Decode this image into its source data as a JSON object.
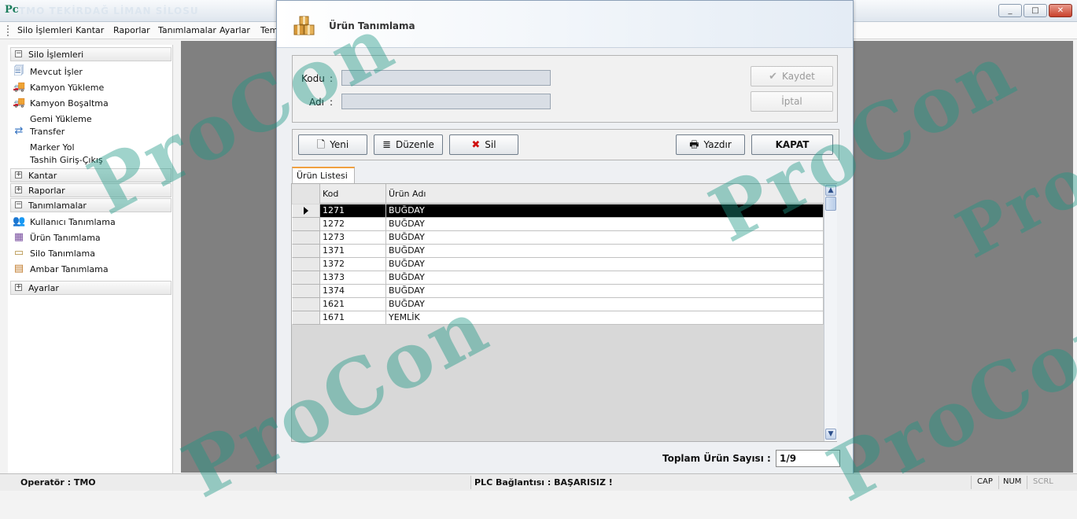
{
  "app": {
    "icon_text": "Pc",
    "title": "TMO TEKİRDAĞ LİMAN SİLOSU",
    "window_buttons": [
      "_",
      "□",
      "✕"
    ]
  },
  "menu": {
    "items": [
      "Silo İşlemleri",
      "Kantar",
      "Raporlar",
      "Tanımlamalar",
      "Ayarlar",
      "Tem"
    ]
  },
  "sidebar": {
    "groups": [
      {
        "label": "Silo İşlemleri",
        "expanded": true,
        "toggle": "−"
      },
      {
        "label": "Kantar",
        "expanded": false,
        "toggle": "+"
      },
      {
        "label": "Raporlar",
        "expanded": false,
        "toggle": "+"
      },
      {
        "label": "Tanımlamalar",
        "expanded": true,
        "toggle": "−"
      },
      {
        "label": "Ayarlar",
        "expanded": false,
        "toggle": "+"
      }
    ],
    "silo_items": [
      {
        "label": "Mevcut İşler",
        "icon": "document-icon"
      },
      {
        "label": "Kamyon Yükleme",
        "icon": "truck-load-icon"
      },
      {
        "label": "Kamyon Boşaltma",
        "icon": "truck-unload-icon"
      },
      {
        "label": "Gemi Yükleme",
        "icon": "transfer-icon"
      },
      {
        "label": "Transfer",
        "icon": "transfer-icon"
      },
      {
        "label": "Marker Yol",
        "icon": ""
      },
      {
        "label": "Tashih Giriş-Çıkış",
        "icon": ""
      }
    ],
    "tanim_items": [
      {
        "label": "Kullanıcı Tanımlama",
        "icon": "users-icon"
      },
      {
        "label": "Ürün Tanımlama",
        "icon": "product-icon"
      },
      {
        "label": "Silo Tanımlama",
        "icon": "silo-icon"
      },
      {
        "label": "Ambar Tanımlama",
        "icon": "warehouse-icon"
      }
    ]
  },
  "dialog": {
    "title": "Ürün Tanımlama",
    "kodu_label": "Kodu",
    "adi_label": "Adı",
    "colon": ":",
    "kodu_value": "",
    "adi_value": "",
    "kaydet_label": "Kaydet",
    "iptal_label": "İptal",
    "yeni_label": "Yeni",
    "duzenle_label": "Düzenle",
    "sil_label": "Sil",
    "yazdir_label": "Yazdır",
    "kapat_label": "KAPAT",
    "tab_label": "Ürün Listesi",
    "columns": [
      "Kod",
      "Ürün Adı"
    ],
    "rows": [
      {
        "kod": "1271",
        "ad": "BUĞDAY",
        "selected": true
      },
      {
        "kod": "1272",
        "ad": "BUĞDAY"
      },
      {
        "kod": "1273",
        "ad": "BUĞDAY"
      },
      {
        "kod": "1371",
        "ad": "BUĞDAY"
      },
      {
        "kod": "1372",
        "ad": "BUĞDAY"
      },
      {
        "kod": "1373",
        "ad": "BUĞDAY"
      },
      {
        "kod": "1374",
        "ad": "BUĞDAY"
      },
      {
        "kod": "1621",
        "ad": "BUĞDAY"
      },
      {
        "kod": "1671",
        "ad": "YEMLİK"
      }
    ],
    "total_label": "Toplam Ürün Sayısı  :",
    "total_value": "1/9"
  },
  "status": {
    "operator": "Operatör : TMO",
    "connection": "PLC Bağlantısı : BAŞARISIZ !",
    "keys": [
      "CAP",
      "NUM",
      "SCRL"
    ]
  },
  "watermark": {
    "text": "ProCon"
  },
  "colors": {
    "accent": "#f0a040",
    "watermark": "#1a9682",
    "selected_row": "#000000",
    "workspace": "#808080"
  }
}
